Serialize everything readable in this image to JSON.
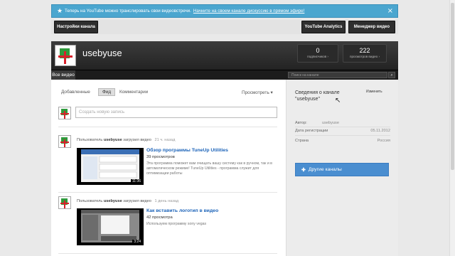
{
  "notice": {
    "icon": "star-icon",
    "text": "Теперь на YouTube можно транслировать свои видеовстречи.",
    "link": "Начните на своем канале дискуссию в прямом эфире!",
    "close": "×"
  },
  "buttons": {
    "settings": "Настройки канала",
    "analytics": "YouTube Analytics",
    "manager": "Менеджер видео"
  },
  "channel": {
    "name": "usebyuse",
    "subscribers": {
      "count": "0",
      "label": "подписчиков ›"
    },
    "views": {
      "count": "222",
      "label": "просмотров видео ›"
    }
  },
  "nav": {
    "all_videos": "Все видео",
    "search_placeholder": "Поиск на канале"
  },
  "feed": {
    "tabs": [
      "Добавленные",
      "Фид",
      "Комментарии"
    ],
    "active_tab": "Фид",
    "sort": "Просмотреть ▾",
    "composer_placeholder": "Создать новую запись",
    "items": [
      {
        "prefix": "Пользователь",
        "user": "usebyuse",
        "action": "загрузил видео",
        "time": "21 ч. назад",
        "title": "Обзор программы TuneUp Utilities",
        "views": "39 просмотров",
        "desc": "Эта программа поможет вам очищать вашу систему как в ручном, так и в автоматическом режиме! TuneUp Utilities - программа служит для оптимизации работы",
        "duration": "11:36"
      },
      {
        "prefix": "Пользователь",
        "user": "usebyuse",
        "action": "загрузил видео",
        "time": "1 день назад",
        "title": "Как вставить логотип в видео",
        "views": "42 просмотра",
        "desc": "Используем программу sony vegas",
        "duration": "3:24"
      }
    ]
  },
  "sidebar": {
    "title": "Сведения о канале \"usebyuse\"",
    "edit": "Изменить",
    "rows": [
      {
        "label": "Автор:",
        "value": "usebyuse"
      },
      {
        "label": "Дата регистрации",
        "value": "05.11.2012"
      },
      {
        "label": "Страна",
        "value": "Россия"
      }
    ],
    "other_channels": "Другие каналы",
    "other_channels_icon": "plus-icon"
  },
  "colors": {
    "notice_bg": "#4ba6cf",
    "link_blue": "#1a62b8",
    "button_blue": "#4a8ed0",
    "header_dark": "#232323"
  }
}
